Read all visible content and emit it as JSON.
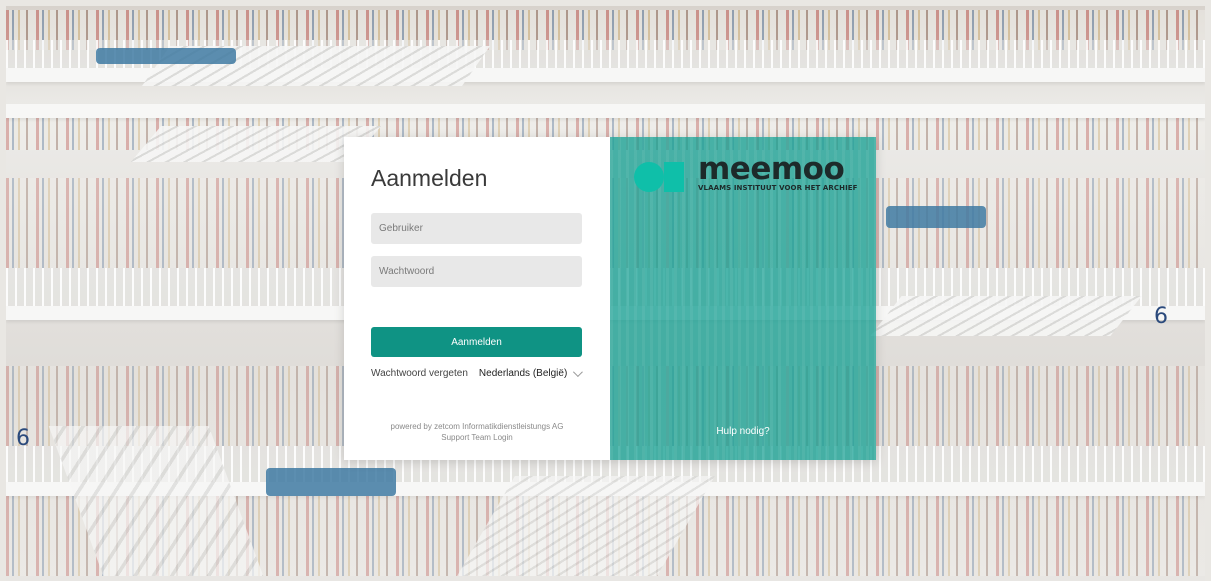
{
  "login": {
    "title": "Aanmelden",
    "username_placeholder": "Gebruiker",
    "password_placeholder": "Wachtwoord",
    "submit_label": "Aanmelden",
    "forgot_label": "Wachtwoord vergeten",
    "language_selected": "Nederlands (België)",
    "powered_by": "powered by zetcom Informatikdienstleistungs AG",
    "support_login": "Support Team Login"
  },
  "brand": {
    "name": "meemoo",
    "tagline": "VLAAMS INSTITUUT VOOR HET ARCHIEF",
    "help_label": "Hulp nodig?",
    "accent_color": "#0f9384",
    "panel_color": "#18a093"
  },
  "background": {
    "description_icon": "library-atrium-image"
  }
}
